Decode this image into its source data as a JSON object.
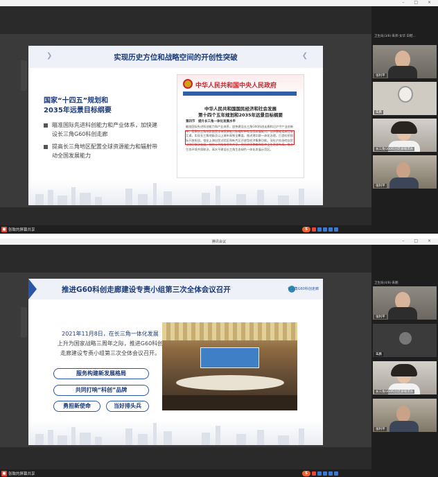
{
  "colors": {
    "brand_blue": "#1b3a7a",
    "accent_red": "#c9242b",
    "dark_bg": "#2b2b2b"
  },
  "panel1": {
    "sidebar_header": "卫生局(3/8)·朱邦·女华 白鞋...",
    "participants": [
      "张利平",
      "朱鹏",
      "长三角G60科创走廊联席办"
    ],
    "slide": {
      "title": "实现历史方位和战略空间的开创性突破",
      "heading_line1": "国家“十四五”规划和",
      "heading_line2": "2035年远景目标纲要",
      "bullets": [
        "瞄准国际先进科创能力和产业体系，加快建设长三角G60科创走廊",
        "提高长三角地区配置全球资源能力和辐射带动全国发展能力"
      ],
      "doc": {
        "site_name": "中华人民共和国中央人民政府",
        "title_line1": "中华人民共和国国民经济和社会发展",
        "title_line2": "第十四个五年规划和2035年远景目标纲要",
        "section": "第四节　提升长三角一体化发展水平",
        "body": "瞄准国际先进科创能力和产业体系，加快建设长三角G60科创走廊和沿沪宁产业创新带，提高长三角地区配置全球资源能力和辐射带动全国发展能力。加快基础设施互联互通，实现长三角地级及以上城市高铁全覆盖，推进港口群一体化治理。打造虹桥国际开放枢纽，强化上海自贸试验区和新片区开放型经济集聚功能。深化沪苏浙皖自贸试验区联动发展。加快公共服务便利共享，优化优质教育和医疗卫生资源布局。推进生态环境共保联治，高水平建设长三角生态绿色一体化发展示范区。"
      }
    },
    "share_label": "张致的屏幕共享"
  },
  "panel2": {
    "window_title": "腾讯会议",
    "sidebar_header": "卫生局(4/8)·朱鹏",
    "participants": [
      "张利平",
      "朱鹏",
      "长三角G60科创走廊联席办"
    ],
    "slide": {
      "title": "推进G60科创走廊建设专责小组第三次全体会议召开",
      "logo_text": "长三角G60科创走廊",
      "paragraph_line1": "2021年11月8日，在长三角一体化发展",
      "paragraph_line2": "上升为国家战略三周年之际，推进G60科创",
      "paragraph_line3": "走廊建设专责小组第三次全体会议召开。",
      "pills": [
        "服务构建新发展格局",
        "共同打响“科创”品牌",
        "勇担新使命",
        "当好排头兵"
      ]
    },
    "share_label": "张致的屏幕共享"
  }
}
